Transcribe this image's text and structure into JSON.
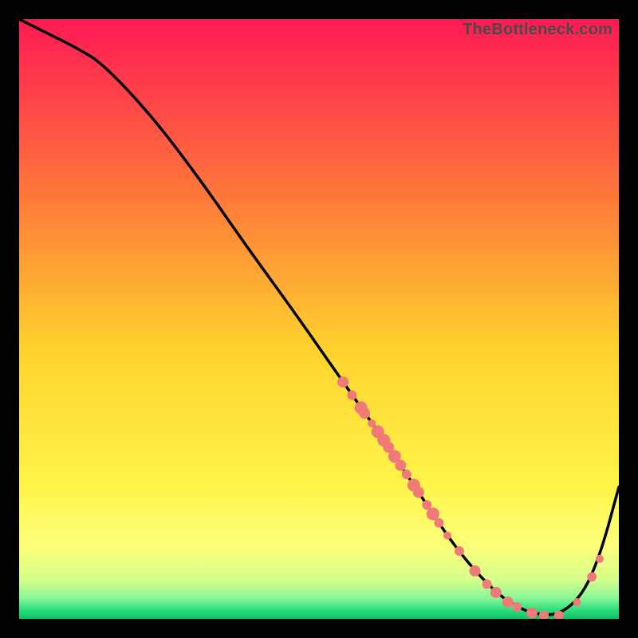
{
  "watermark": "TheBottleneck.com",
  "chart_data": {
    "type": "line",
    "title": "",
    "xlabel": "",
    "ylabel": "",
    "xlim": [
      0,
      100
    ],
    "ylim": [
      0,
      100
    ],
    "grid": false,
    "background_gradient_stops": [
      {
        "offset": 0.0,
        "color": "#ff1a54"
      },
      {
        "offset": 0.3,
        "color": "#ff7a3a"
      },
      {
        "offset": 0.55,
        "color": "#ffd22e"
      },
      {
        "offset": 0.78,
        "color": "#fff54a"
      },
      {
        "offset": 0.88,
        "color": "#fdff7a"
      },
      {
        "offset": 0.935,
        "color": "#d6ff8a"
      },
      {
        "offset": 0.965,
        "color": "#8af79a"
      },
      {
        "offset": 0.985,
        "color": "#2be07a"
      },
      {
        "offset": 1.0,
        "color": "#0fc06a"
      }
    ],
    "series": [
      {
        "name": "curve",
        "type": "line",
        "color": "#000000",
        "x": [
          0,
          4,
          10,
          14,
          22,
          30,
          38,
          46,
          54,
          60,
          64,
          68,
          72,
          76,
          80,
          83,
          86,
          90,
          94,
          97,
          100
        ],
        "y": [
          100,
          98,
          95,
          92.5,
          84,
          73.5,
          62,
          51,
          39.5,
          31,
          25,
          19,
          13,
          8,
          4,
          2,
          0.8,
          0.6,
          4,
          11,
          22
        ]
      },
      {
        "name": "markers",
        "type": "scatter",
        "color": "#f07a78",
        "points": [
          {
            "x": 54.0,
            "y": 39.5,
            "r": 7
          },
          {
            "x": 55.5,
            "y": 37.3,
            "r": 6
          },
          {
            "x": 57.0,
            "y": 35.2,
            "r": 8
          },
          {
            "x": 57.6,
            "y": 34.3,
            "r": 7
          },
          {
            "x": 58.8,
            "y": 32.6,
            "r": 5
          },
          {
            "x": 59.8,
            "y": 31.2,
            "r": 8
          },
          {
            "x": 60.8,
            "y": 29.8,
            "r": 8
          },
          {
            "x": 61.6,
            "y": 28.6,
            "r": 7
          },
          {
            "x": 62.6,
            "y": 27.1,
            "r": 8
          },
          {
            "x": 63.6,
            "y": 25.6,
            "r": 7
          },
          {
            "x": 64.6,
            "y": 24.1,
            "r": 6
          },
          {
            "x": 65.8,
            "y": 22.3,
            "r": 8
          },
          {
            "x": 66.6,
            "y": 21.1,
            "r": 7
          },
          {
            "x": 68.0,
            "y": 19.0,
            "r": 6
          },
          {
            "x": 69.0,
            "y": 17.5,
            "r": 8
          },
          {
            "x": 70.0,
            "y": 16.0,
            "r": 6
          },
          {
            "x": 71.4,
            "y": 13.9,
            "r": 5
          },
          {
            "x": 73.4,
            "y": 11.3,
            "r": 6
          },
          {
            "x": 76.0,
            "y": 8.0,
            "r": 7
          },
          {
            "x": 78.0,
            "y": 5.8,
            "r": 6
          },
          {
            "x": 79.5,
            "y": 4.4,
            "r": 7
          },
          {
            "x": 81.5,
            "y": 2.8,
            "r": 7
          },
          {
            "x": 83.0,
            "y": 2.0,
            "r": 6
          },
          {
            "x": 85.5,
            "y": 1.0,
            "r": 7
          },
          {
            "x": 87.5,
            "y": 0.6,
            "r": 6
          },
          {
            "x": 90.0,
            "y": 0.6,
            "r": 6
          },
          {
            "x": 93.0,
            "y": 2.8,
            "r": 5
          },
          {
            "x": 95.5,
            "y": 7.0,
            "r": 6
          },
          {
            "x": 96.8,
            "y": 10.0,
            "r": 5
          }
        ]
      }
    ]
  }
}
